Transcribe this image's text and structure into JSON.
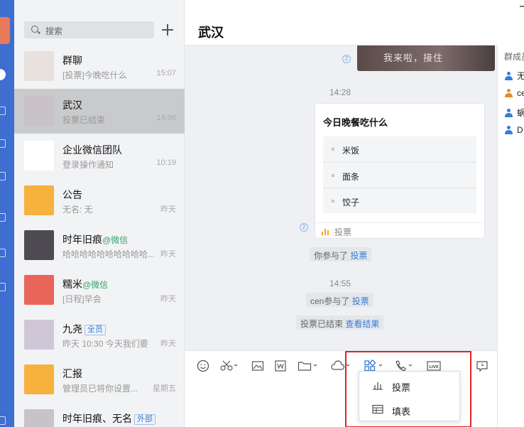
{
  "search": {
    "placeholder": "搜索"
  },
  "conversations": [
    {
      "name": "群聊",
      "tag": "",
      "tag_type": "",
      "preview": "[投票]今晚吃什么",
      "time": "15:07",
      "active": false
    },
    {
      "name": "武汉",
      "tag": "",
      "tag_type": "",
      "preview": "投票已结束",
      "time": "14:56",
      "active": true
    },
    {
      "name": "企业微信团队",
      "tag": "",
      "tag_type": "",
      "preview": "登录操作通知",
      "time": "10:19",
      "active": false
    },
    {
      "name": "公告",
      "tag": "",
      "tag_type": "",
      "preview": "无名: 无",
      "time": "昨天",
      "active": false
    },
    {
      "name": "时年旧痕",
      "tag": "@微信",
      "tag_type": "wx",
      "preview": "哈哈哈哈哈哈哈哈哈哈...",
      "time": "昨天",
      "active": false
    },
    {
      "name": "糯米",
      "tag": "@微信",
      "tag_type": "wx",
      "preview": "[日程]早会",
      "time": "昨天",
      "active": false
    },
    {
      "name": "九尧",
      "tag": "全员",
      "tag_type": "box",
      "preview": "昨天 10:30 今天我们要",
      "time": "昨天",
      "active": false
    },
    {
      "name": "汇报",
      "tag": "",
      "tag_type": "",
      "preview": "管理员已将你设置...",
      "time": "星期五",
      "active": false
    },
    {
      "name": "时年旧痕、无名",
      "tag": "外部",
      "tag_type": "box",
      "preview": "",
      "time": "",
      "active": false
    }
  ],
  "chat": {
    "title": "武汉",
    "image_caption": "我来啦，接住",
    "read_count_1": "2",
    "time_1": "14:28",
    "vote": {
      "title": "今日晚餐吃什么",
      "options": [
        "米饭",
        "面条",
        "饺子"
      ],
      "footer": "投票",
      "read_count": "2"
    },
    "sys_1": {
      "text": "你参与了",
      "link": "投票"
    },
    "time_2": "14:55",
    "sys_2": {
      "text": "cen参与了",
      "link": "投票"
    },
    "sys_3": {
      "text": "投票已结束",
      "link": "查看结果"
    }
  },
  "toolbar": {
    "icons": [
      "emoji-icon",
      "scissors-icon",
      "image-icon",
      "word-icon",
      "folder-icon",
      "cloud-icon",
      "apps-icon",
      "phone-icon",
      "live-icon",
      "history-icon"
    ],
    "live_label": "LIVE"
  },
  "popup": {
    "items": [
      {
        "label": "投票",
        "icon": "bar-chart-icon"
      },
      {
        "label": "填表",
        "icon": "table-icon"
      }
    ]
  },
  "members": {
    "header": "群成员",
    "list": [
      {
        "name": "无名",
        "color": "#3a7bd5"
      },
      {
        "name": "cen",
        "color": "#e98a2c"
      },
      {
        "name": "蜗牛",
        "color": "#3a7bd5"
      },
      {
        "name": "D",
        "color": "#3a7bd5"
      }
    ]
  },
  "colors": {
    "rail": "#3d6ed0",
    "accent_link": "#3a7bd5",
    "highlight": "#e02424",
    "wechat_tag": "#36a36e"
  }
}
